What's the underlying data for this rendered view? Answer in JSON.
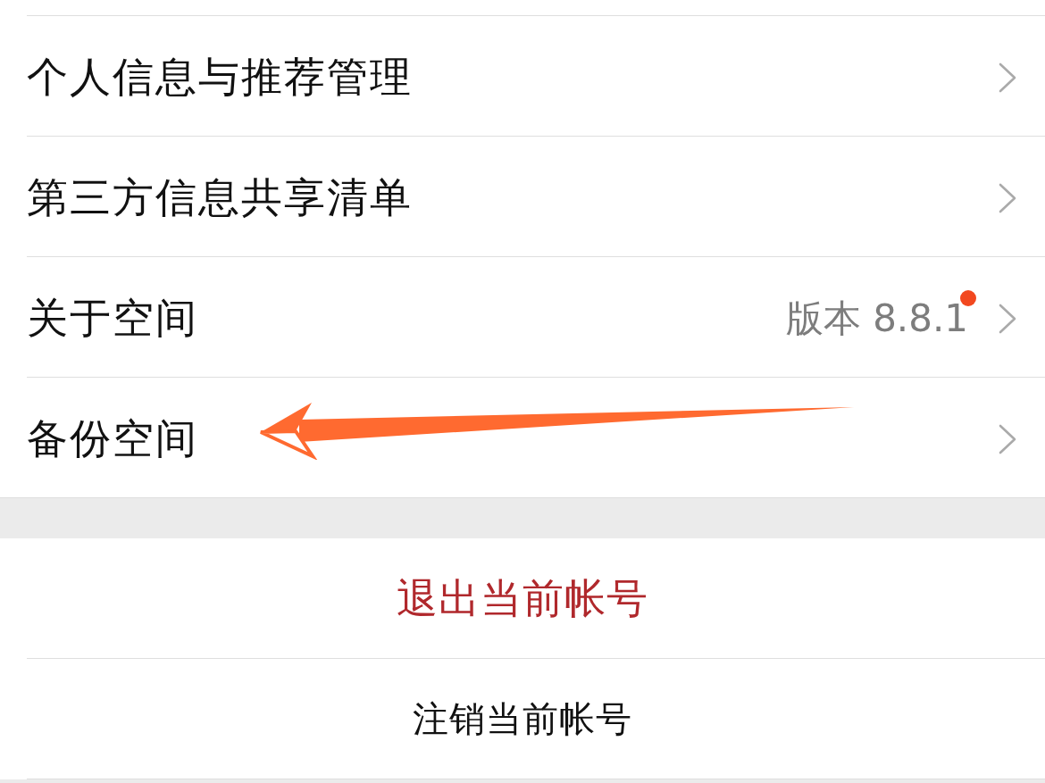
{
  "menu": [
    {
      "label": "个人信息与推荐管理",
      "dot": false,
      "arrow": false
    },
    {
      "label": "第三方信息共享清单",
      "dot": false,
      "arrow": false
    },
    {
      "label": "关于空间",
      "value": "版本 8.8.1",
      "dot": true,
      "arrow": false
    },
    {
      "label": "备份空间",
      "dot": false,
      "arrow": true
    }
  ],
  "account_actions": [
    {
      "label": "退出当前帐号",
      "kind": "danger"
    },
    {
      "label": "注销当前帐号",
      "kind": "normal"
    }
  ]
}
